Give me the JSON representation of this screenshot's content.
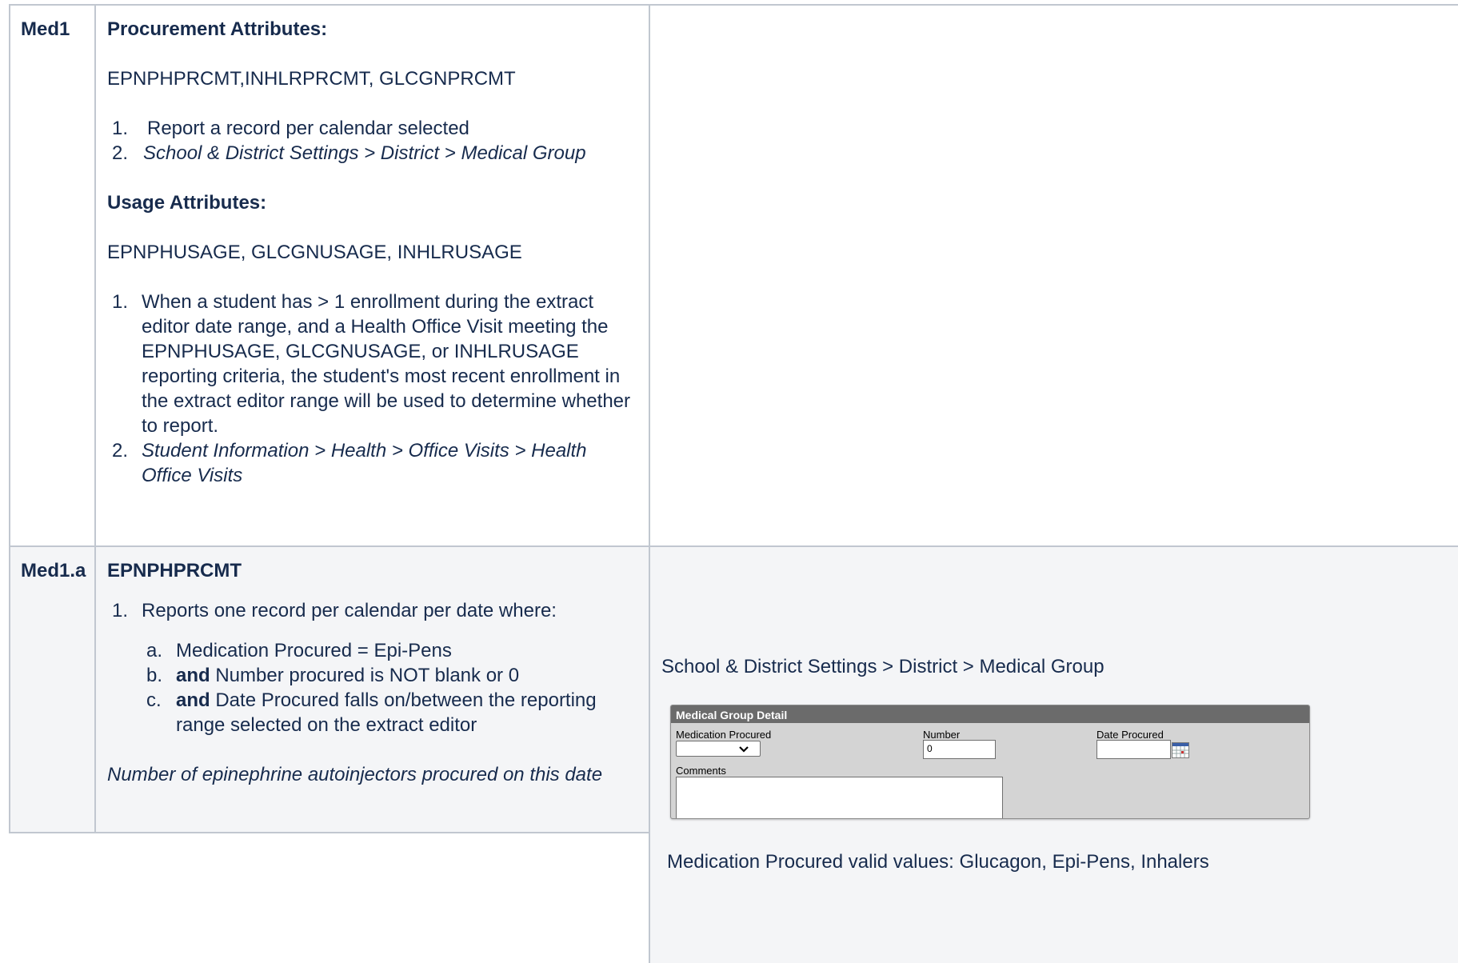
{
  "row1": {
    "label": "Med1",
    "procurement_heading": "Procurement Attributes:",
    "procurement_codes": "EPNPHPRCMT,INHLRPRCMT, GLCGNPRCMT",
    "procurement_list": [
      {
        "num": "1.",
        "text": "Report a record per calendar selected"
      },
      {
        "num": "2.",
        "text": "School & District Settings > District > Medical Group"
      }
    ],
    "usage_heading": "Usage Attributes:",
    "usage_codes": "EPNPHUSAGE, GLCGNUSAGE, INHLRUSAGE",
    "usage_list": [
      {
        "num": "1.",
        "text": "When a student has > 1 enrollment during the extract editor date range, and a Health Office Visit meeting the EPNPHUSAGE, GLCGNUSAGE, or INHLRUSAGE reporting criteria, the student's most recent enrollment in the extract editor range will be used to determine whether to report."
      },
      {
        "num": "2.",
        "text": "Student Information >  Health > Office Visits > Health Office Visits"
      }
    ]
  },
  "row2": {
    "label": "Med1.a",
    "heading": "EPNPHPRCMT",
    "list": [
      {
        "num": "1.",
        "text": "Reports one record per calendar per date where:"
      }
    ],
    "sublist": [
      {
        "num": "a.",
        "bold": "",
        "text": "Medication Procured = Epi-Pens"
      },
      {
        "num": "b.",
        "bold": "and",
        "text": " Number procured is NOT blank or 0"
      },
      {
        "num": "c.",
        "bold": "and",
        "text": " Date Procured falls on/between the reporting range selected on the extract editor"
      }
    ],
    "note": "Number of epinephrine autoinjectors procured on this date",
    "path": "School & District Settings > District > Medical Group",
    "widget": {
      "header": "Medical Group Detail",
      "medication_label": "Medication Procured",
      "medication_value": "",
      "number_label": "Number",
      "number_value": "0",
      "date_label": "Date Procured",
      "date_value": "",
      "comments_label": "Comments",
      "comments_value": ""
    },
    "valid_values": "Medication Procured valid values: Glucagon, Epi-Pens, Inhalers"
  },
  "colors": {
    "text": "#172b4d",
    "border": "#c1c7d0",
    "row_shade": "#f4f5f7",
    "widget_bg": "#d4d4d4",
    "widget_header": "#6b6b6b"
  }
}
